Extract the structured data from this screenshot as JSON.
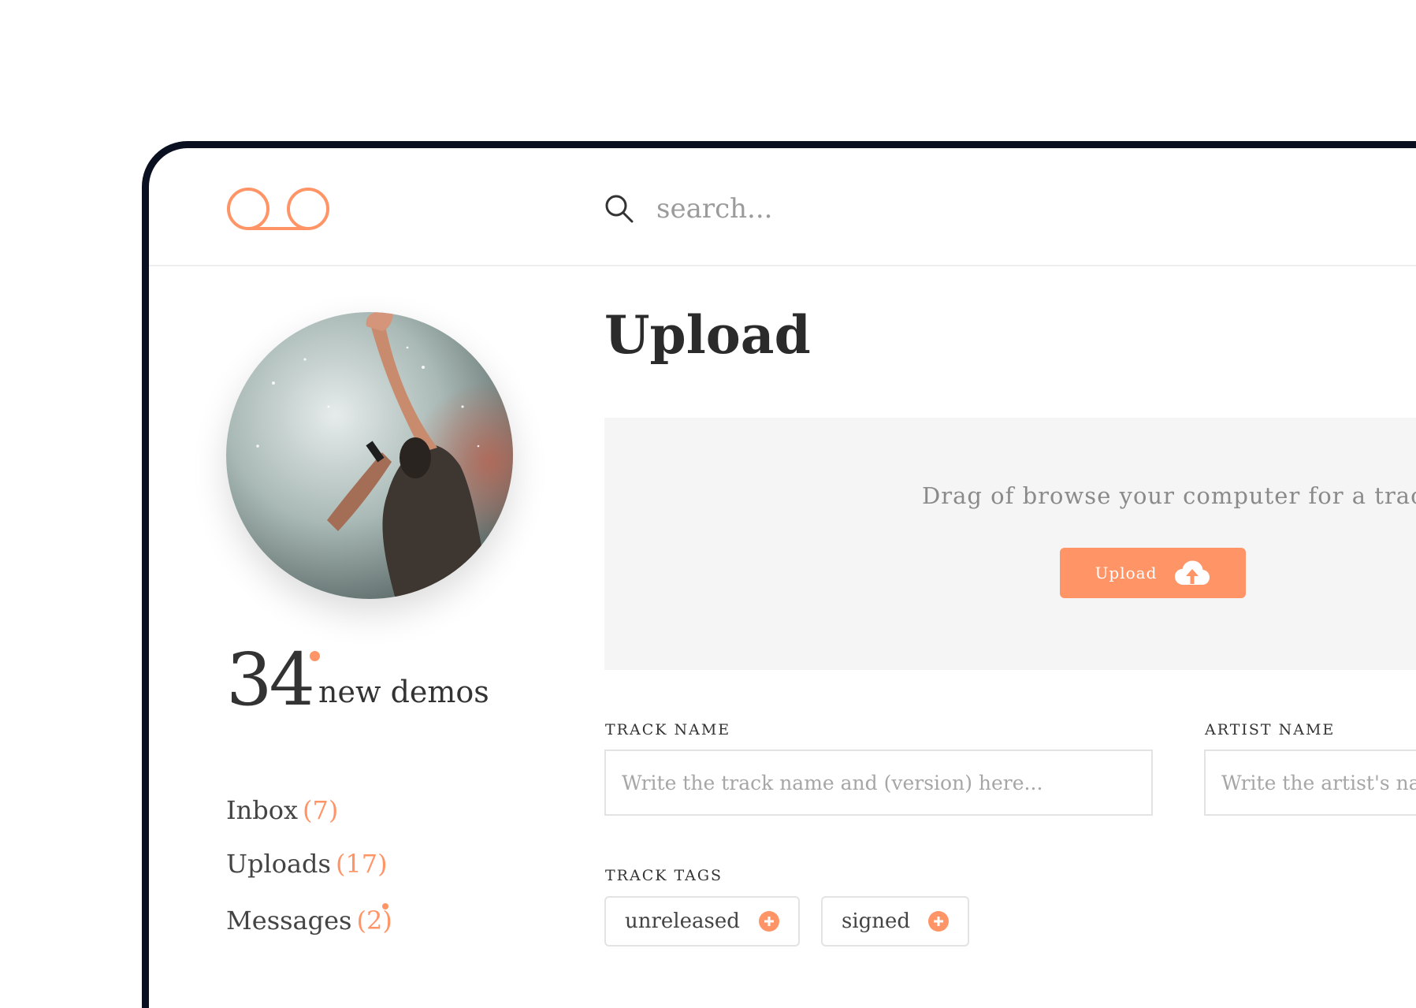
{
  "search": {
    "placeholder": "search..."
  },
  "profile": {
    "count": "34",
    "count_label": "new demos"
  },
  "nav": [
    {
      "label": "Inbox",
      "count": "(7)"
    },
    {
      "label": "Uploads",
      "count": "(17)"
    },
    {
      "label": "Messages",
      "count": "(2)"
    }
  ],
  "main": {
    "title": "Upload",
    "dropzone": {
      "text": "Drag of browse your computer for a track",
      "button_label": "Upload"
    },
    "track_name": {
      "label": "TRACK NAME",
      "placeholder": "Write the track name and (version) here..."
    },
    "artist_name": {
      "label": "ARTIST NAME",
      "placeholder": "Write the artist's name here..."
    },
    "track_tags": {
      "label": "TRACK TAGS",
      "tags": [
        "unreleased",
        "signed"
      ]
    }
  },
  "colors": {
    "accent": "#ff9466",
    "frame": "#0b1020",
    "dropzone_bg": "#f5f5f5"
  },
  "icons": {
    "logo": "voicemail-logo",
    "search": "search-icon",
    "upload": "cloud-upload-icon",
    "tag_add": "plus-circle-icon"
  }
}
